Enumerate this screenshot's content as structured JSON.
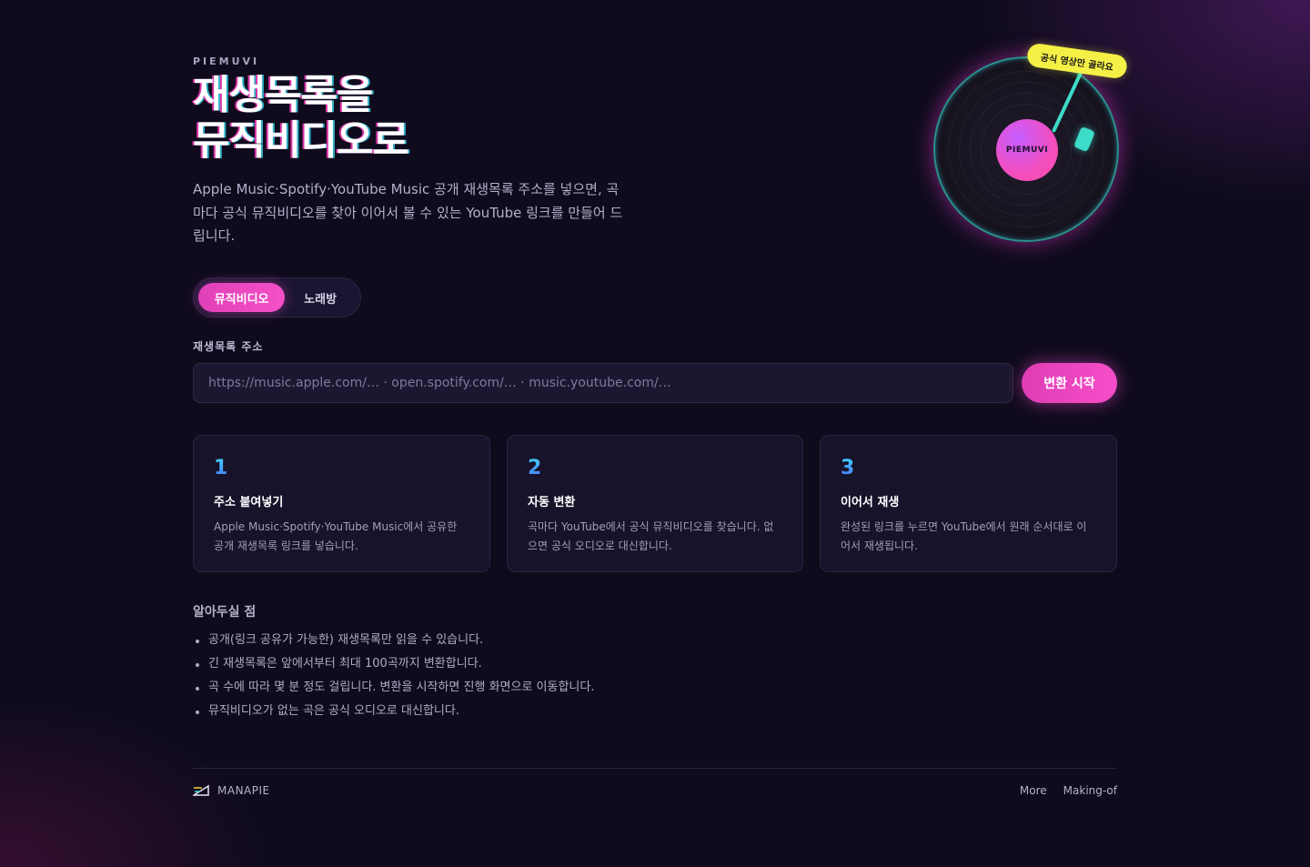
{
  "brand": "PIEMUVI",
  "hero": {
    "title_line1": "재생목록을",
    "title_line2": "뮤직비디오로",
    "description": "Apple Music·Spotify·YouTube Music 공개 재생목록 주소를 넣으면, 곡마다 공식 뮤직비디오를 찾아 이어서 볼 수 있는 YouTube 링크를 만들어 드립니다."
  },
  "mode_toggle": {
    "options": [
      "뮤직비디오",
      "노래방"
    ],
    "selected": "뮤직비디오"
  },
  "form": {
    "label": "재생목록 주소",
    "placeholder": "https://music.apple.com/… · open.spotify.com/… · music.youtube.com/…",
    "value": "",
    "submit_label": "변환 시작"
  },
  "steps": [
    {
      "num": "1",
      "title": "주소 붙여넣기",
      "body": "Apple Music·Spotify·YouTube Music에서 공유한 공개 재생목록 링크를 넣습니다."
    },
    {
      "num": "2",
      "title": "자동 변환",
      "body": "곡마다 YouTube에서 공식 뮤직비디오를 찾습니다. 없으면 공식 오디오로 대신합니다."
    },
    {
      "num": "3",
      "title": "이어서 재생",
      "body": "완성된 링크를 누르면 YouTube에서 원래 순서대로 이어서 재생됩니다."
    }
  ],
  "notes": {
    "title": "알아두실 점",
    "items": [
      "공개(링크 공유가 가능한) 재생목록만 읽을 수 있습니다.",
      "긴 재생목록은 앞에서부터 최대 100곡까지 변환합니다.",
      "곡 수에 따라 몇 분 정도 걸립니다. 변환을 시작하면 진행 화면으로 이동합니다.",
      "뮤직비디오가 없는 곡은 공식 오디오로 대신합니다."
    ]
  },
  "vinyl": {
    "label": "PIEMUVI",
    "sticker": "공식 영상만 골라요"
  },
  "footer": {
    "logo_text": "MANAPIE",
    "links": [
      "More",
      "Making-of"
    ]
  },
  "colors": {
    "background": "#0f0b1d",
    "accent_pink": "#f04ec6",
    "accent_cyan": "#3ddcc8",
    "sticker_yellow": "#f4f045"
  }
}
